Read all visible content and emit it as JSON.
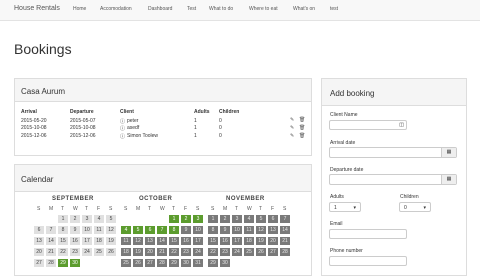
{
  "nav": {
    "brand": "House Rentals",
    "items": [
      "Home",
      "Accomodation",
      "Dashboard",
      "Test",
      "What to do",
      "Where to eat",
      "What's on",
      "test"
    ]
  },
  "page": {
    "title": "Bookings"
  },
  "bookings_panel": {
    "title": "Casa Aurum",
    "headers": [
      "Arrival",
      "Departure",
      "Client",
      "Adults",
      "Children"
    ],
    "rows": [
      {
        "arrival": "2015-05-20",
        "departure": "2015-05-07",
        "client": "peter",
        "adults": "1",
        "children": "0"
      },
      {
        "arrival": "2015-10-08",
        "departure": "2015-10-08",
        "client": "asedf",
        "adults": "1",
        "children": "0"
      },
      {
        "arrival": "2015-12-06",
        "departure": "2015-12-06",
        "client": "Simon Toolew",
        "adults": "1",
        "children": "0"
      }
    ]
  },
  "calendar_panel": {
    "title": "Calendar",
    "days_of_week": [
      "S",
      "M",
      "T",
      "W",
      "T",
      "F",
      "S"
    ],
    "months": [
      {
        "name": "SEPTEMBER",
        "weeks": [
          [
            "",
            "",
            "1",
            "2",
            "3",
            "4",
            "5"
          ],
          [
            "6",
            "7",
            "8",
            "9",
            "10",
            "11",
            "12"
          ],
          [
            "13",
            "14",
            "15",
            "16",
            "17",
            "18",
            "19"
          ],
          [
            "20",
            "21",
            "22",
            "23",
            "24",
            "25",
            "26"
          ],
          [
            "27",
            "28",
            "29",
            "30",
            "",
            "",
            ""
          ]
        ],
        "booked": [
          "29",
          "30"
        ]
      },
      {
        "name": "OCTOBER",
        "weeks": [
          [
            "",
            "",
            "",
            "",
            "1",
            "2",
            "3"
          ],
          [
            "4",
            "5",
            "6",
            "7",
            "8",
            "9",
            "10"
          ],
          [
            "11",
            "12",
            "13",
            "14",
            "15",
            "16",
            "17"
          ],
          [
            "18",
            "19",
            "20",
            "21",
            "22",
            "23",
            "24"
          ],
          [
            "25",
            "26",
            "27",
            "28",
            "29",
            "30",
            "31"
          ]
        ],
        "booked": [
          "1",
          "2",
          "3",
          "4",
          "5",
          "6",
          "7",
          "8"
        ]
      },
      {
        "name": "NOVEMBER",
        "weeks": [
          [
            "1",
            "2",
            "3",
            "4",
            "5",
            "6",
            "7"
          ],
          [
            "8",
            "9",
            "10",
            "11",
            "12",
            "13",
            "14"
          ],
          [
            "15",
            "16",
            "17",
            "18",
            "19",
            "20",
            "21"
          ],
          [
            "22",
            "23",
            "24",
            "25",
            "26",
            "27",
            "28"
          ],
          [
            "29",
            "30",
            "",
            "",
            "",
            "",
            ""
          ]
        ],
        "booked": []
      }
    ]
  },
  "add_booking": {
    "title": "Add booking",
    "client_label": "Client Name",
    "arrival_label": "Arrival date",
    "departure_label": "Departure date",
    "adults_label": "Adults",
    "adults_value": "1",
    "children_label": "Children",
    "children_value": "0",
    "email_label": "Email",
    "phone_label": "Phone number"
  }
}
